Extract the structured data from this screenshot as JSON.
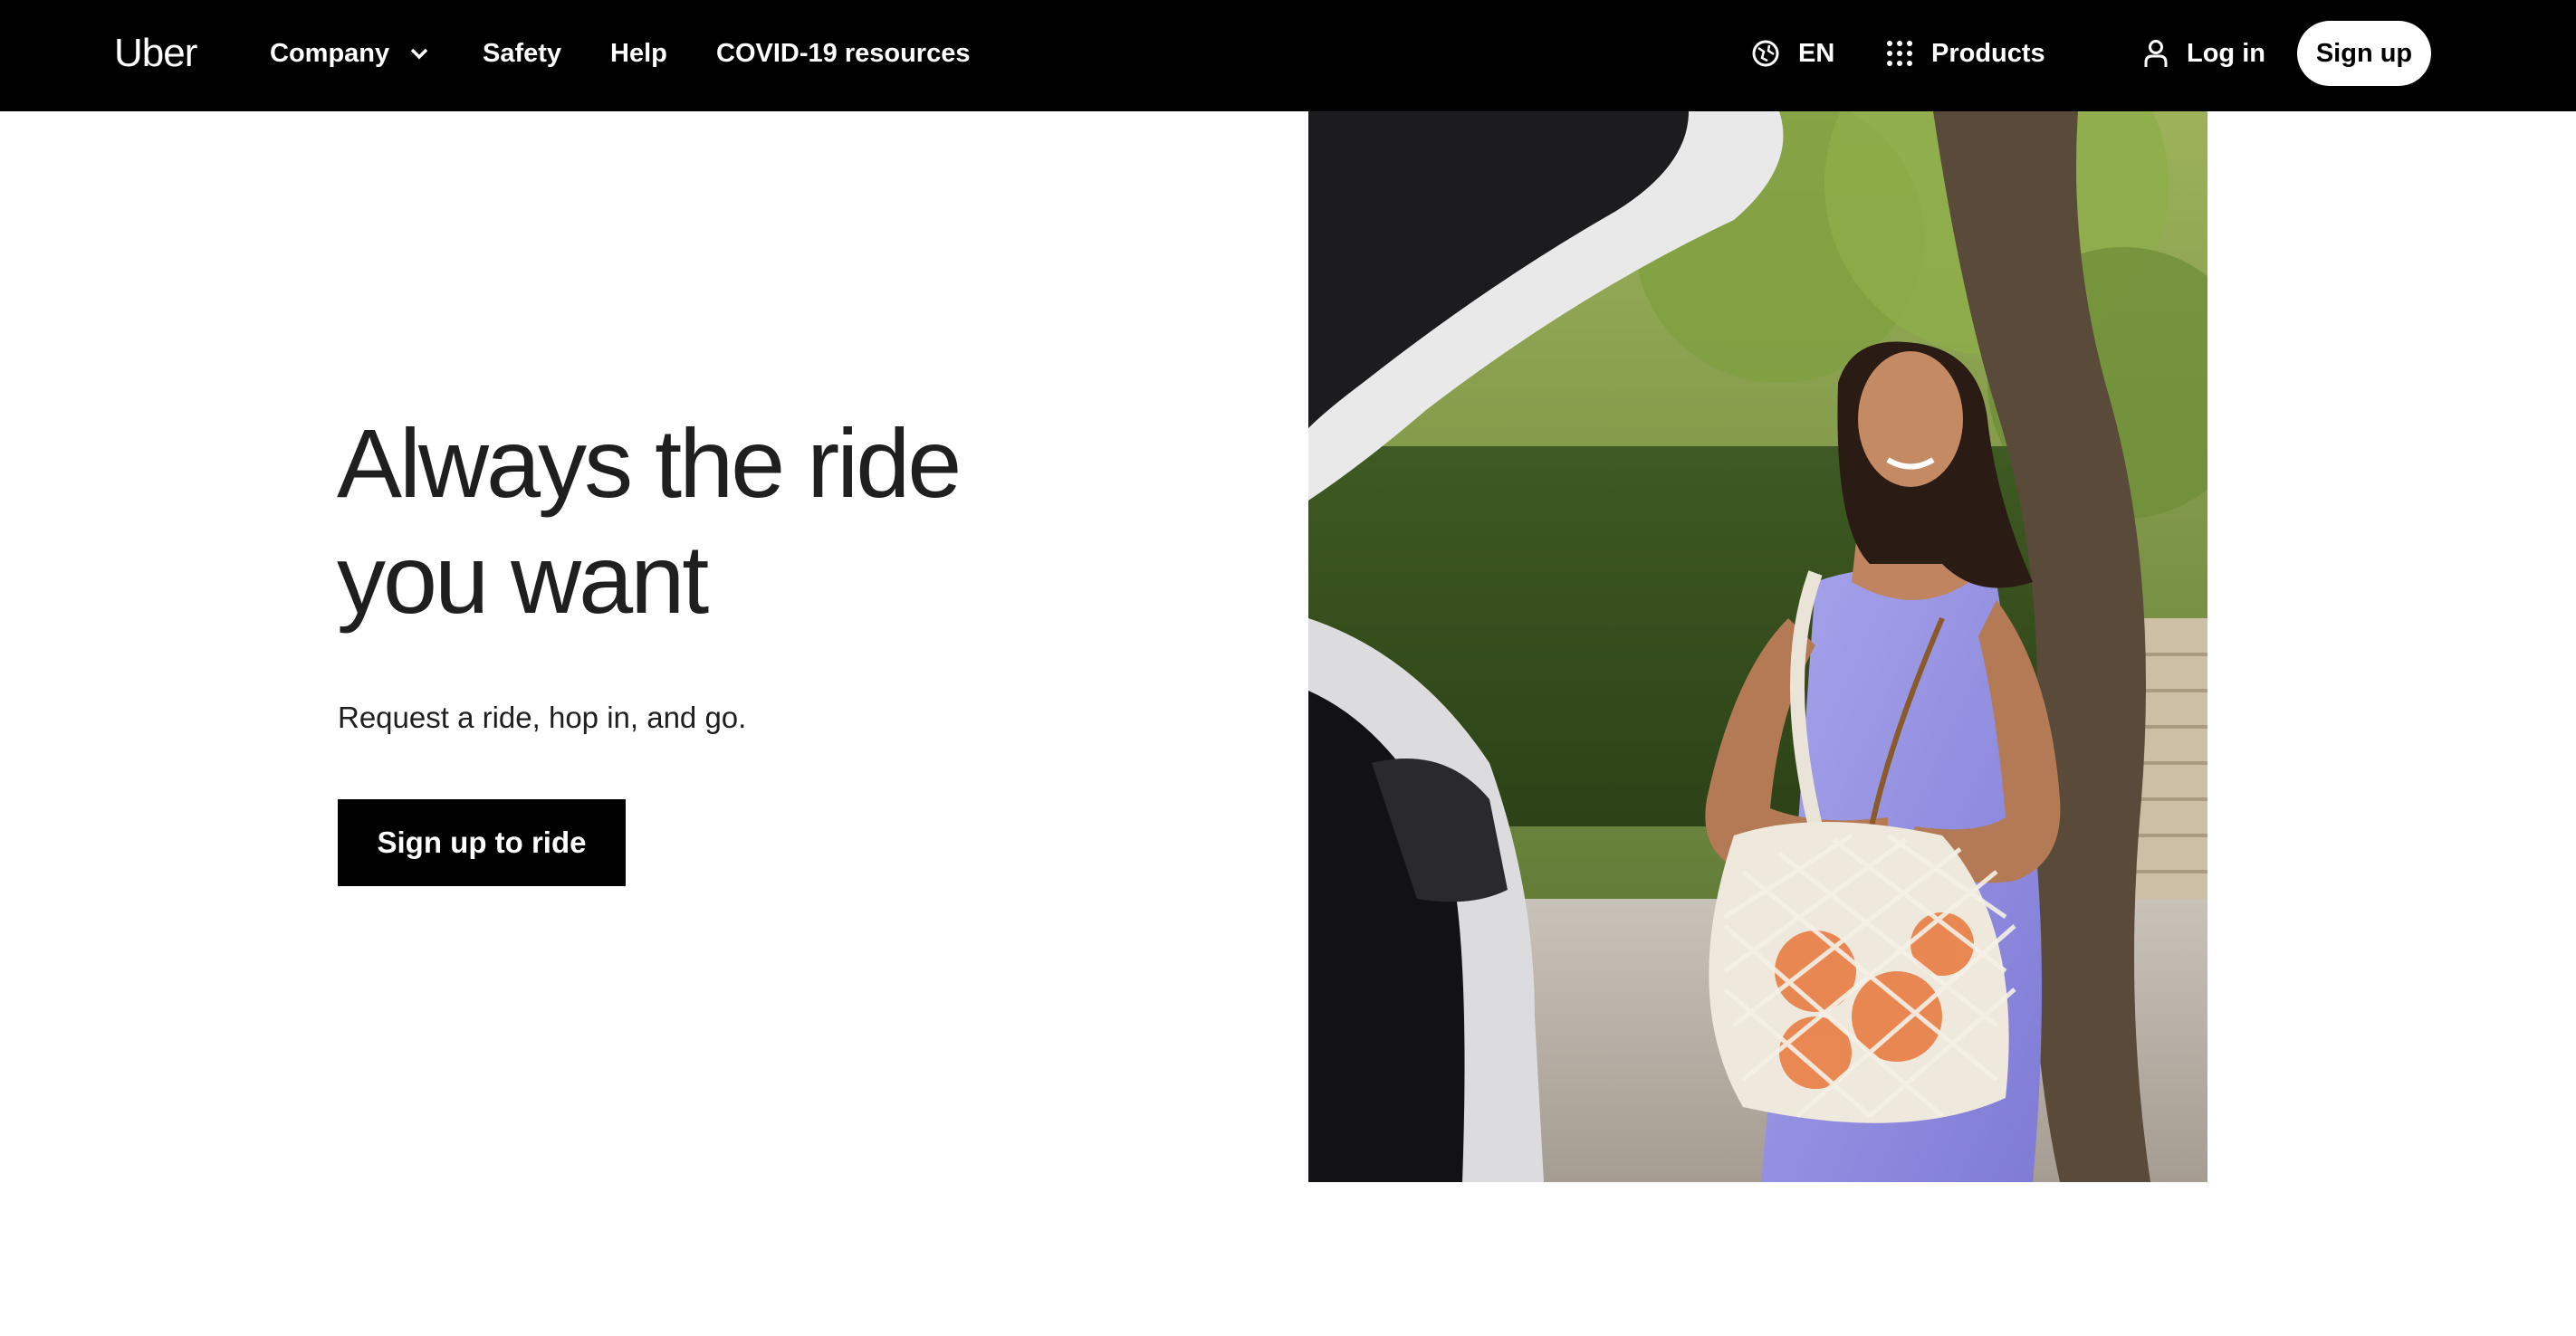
{
  "nav": {
    "logo": "Uber",
    "company": "Company",
    "safety": "Safety",
    "help": "Help",
    "covid": "COVID-19 resources",
    "language": "EN",
    "products": "Products",
    "login": "Log in",
    "signup": "Sign up"
  },
  "hero": {
    "title_line1": "Always the ride",
    "title_line2": "you want",
    "subtitle": "Request a ride, hop in, and go.",
    "cta": "Sign up to ride"
  },
  "icons": {
    "language": "globe-icon",
    "products": "grid-dots-icon",
    "login": "person-icon",
    "company": "chevron-down-icon"
  },
  "colors": {
    "nav_bg": "#000000",
    "cta_bg": "#000000",
    "signup_bg": "#ffffff",
    "text_dark": "#1f1f1f"
  }
}
